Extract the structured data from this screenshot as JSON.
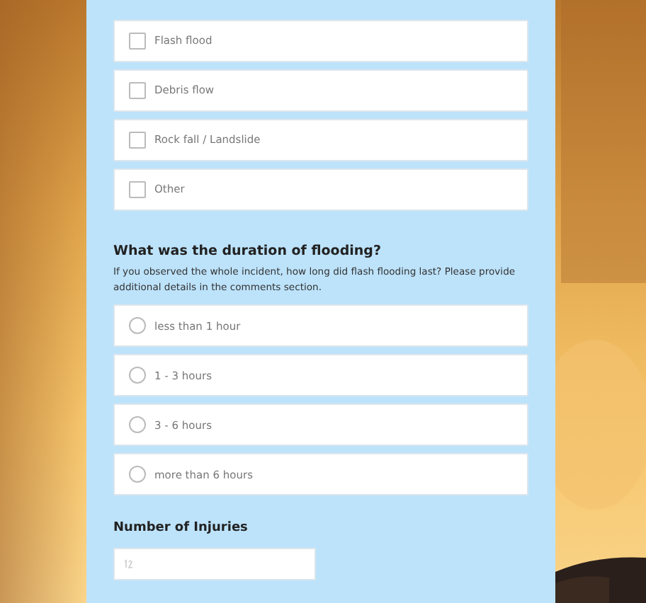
{
  "incident_types": [
    {
      "label": "Flash flood",
      "checked": false
    },
    {
      "label": "Debris flow",
      "checked": false
    },
    {
      "label": "Rock fall / Landslide",
      "checked": false
    },
    {
      "label": "Other",
      "checked": false
    }
  ],
  "duration": {
    "question": "What was the duration of flooding?",
    "description": "If you observed the whole incident,  how long did flash flooding last? Please provide additional details in the comments section.",
    "options": [
      {
        "label": "less than 1 hour",
        "selected": false
      },
      {
        "label": "1 - 3 hours",
        "selected": false
      },
      {
        "label": "3 - 6 hours",
        "selected": false
      },
      {
        "label": "more than 6 hours",
        "selected": false
      }
    ]
  },
  "injuries": {
    "label": "Number of Injuries"
  }
}
